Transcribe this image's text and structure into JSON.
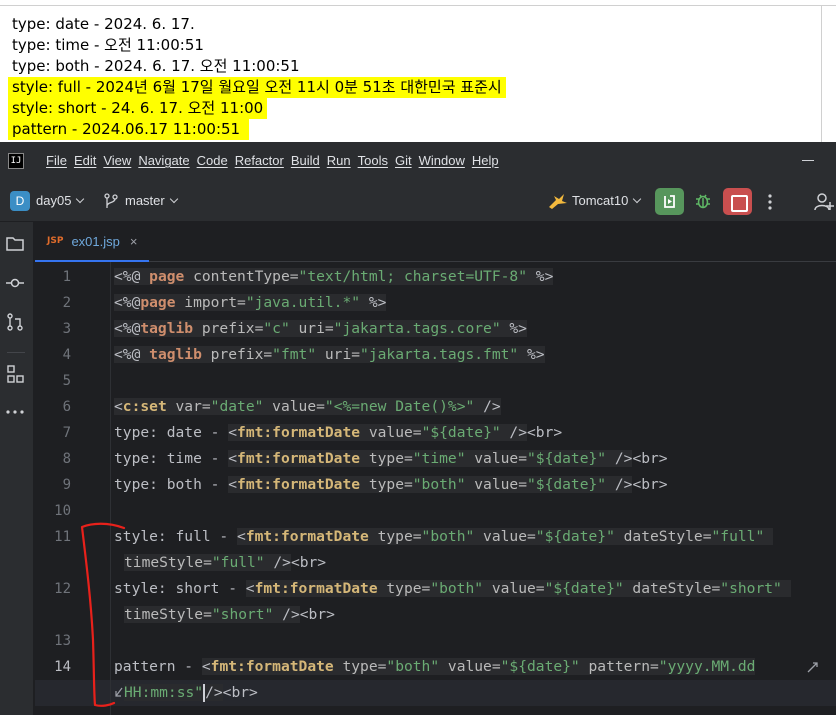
{
  "output": {
    "lines": [
      {
        "text": "type: date - 2024. 6. 17.",
        "highlight": false
      },
      {
        "text": "type: time - 오전 11:00:51",
        "highlight": false
      },
      {
        "text": "type: both - 2024. 6. 17. 오전 11:00:51",
        "highlight": false
      },
      {
        "text": "style: full - 2024년 6월 17일 월요일 오전 11시 0분 51초 대한민국 표준시",
        "highlight": true
      },
      {
        "text": "style: short - 24. 6. 17. 오전 11:00",
        "highlight": true
      },
      {
        "text": "pattern - 2024.06.17 11:00:51 ",
        "highlight": true
      }
    ],
    "highlight_color": "#ffff00"
  },
  "menubar": {
    "logo": "IJ",
    "items": [
      "File",
      "Edit",
      "View",
      "Navigate",
      "Code",
      "Refactor",
      "Build",
      "Run",
      "Tools",
      "Git",
      "Window",
      "Help"
    ]
  },
  "toolbar": {
    "project_badge": "D",
    "project_name": "day05",
    "branch_name": "master",
    "run_config": "Tomcat10",
    "colors": {
      "rerun": "#57965c",
      "stop": "#c94f4f",
      "project_badge": "#3b8ec5"
    }
  },
  "toolstrip": {
    "icons": [
      "folder-icon",
      "commit-icon",
      "pull-requests-icon",
      "structure-icon",
      "more-tools-icon"
    ]
  },
  "tabs": [
    {
      "icon_label": "JSP",
      "label": "ex01.jsp",
      "close": "×",
      "active": true
    }
  ],
  "editor": {
    "line_numbers": [
      "1",
      "2",
      "3",
      "4",
      "5",
      "6",
      "7",
      "8",
      "9",
      "10",
      "11",
      "12",
      "13",
      "14"
    ],
    "colors": {
      "keyword": "#cf8e6d",
      "tag": "#d5b778",
      "string": "#6aab73",
      "text": "#bcbec4",
      "background": "#1e1f22"
    },
    "code": {
      "l1": [
        "<%@ ",
        "page",
        " contentType=",
        "\"text/html; charset=UTF-8\"",
        " %>"
      ],
      "l2": [
        "<%@",
        "page",
        " import=",
        "\"java.util.*\"",
        " %>"
      ],
      "l3": [
        "<%@",
        "taglib",
        " prefix=",
        "\"c\"",
        " uri=",
        "\"jakarta.tags.core\"",
        " %>"
      ],
      "l4": [
        "<%@ ",
        "taglib",
        " prefix=",
        "\"fmt\"",
        " uri=",
        "\"jakarta.tags.fmt\"",
        " %>"
      ],
      "l6": [
        "<",
        "c:set",
        " var=",
        "\"date\"",
        " value=",
        "\"<%=new Date()%>\"",
        " />"
      ],
      "l7": [
        "type: date - ",
        "<",
        "fmt:formatDate",
        " value=",
        "\"${date}\"",
        " />",
        "<br>"
      ],
      "l8": [
        "type: time - ",
        "<",
        "fmt:formatDate",
        " type=",
        "\"time\"",
        " value=",
        "\"${date}\"",
        " />",
        "<br>"
      ],
      "l9": [
        "type: both - ",
        "<",
        "fmt:formatDate",
        " type=",
        "\"both\"",
        " value=",
        "\"${date}\"",
        " />",
        "<br>"
      ],
      "l11": [
        "style: full - ",
        "<",
        "fmt:formatDate",
        " type=",
        "\"both\"",
        " value=",
        "\"${date}\"",
        " dateStyle=",
        "\"full\""
      ],
      "l11b": [
        "timeStyle=",
        "\"full\"",
        " />",
        "<br>"
      ],
      "l12": [
        "style: short - ",
        "<",
        "fmt:formatDate",
        " type=",
        "\"both\"",
        " value=",
        "\"${date}\"",
        " dateStyle=",
        "\"short\""
      ],
      "l12b": [
        "timeStyle=",
        "\"short\"",
        " />",
        "<br>"
      ],
      "l14": [
        "pattern - ",
        "<",
        "fmt:formatDate",
        " type=",
        "\"both\"",
        " value=",
        "\"${date}\"",
        " pattern=",
        "\"yyyy.MM.dd"
      ],
      "l14b": [
        "HH:mm:ss\"",
        "/>",
        "<br>"
      ]
    }
  },
  "annotation": {
    "color": "#e8211b"
  }
}
